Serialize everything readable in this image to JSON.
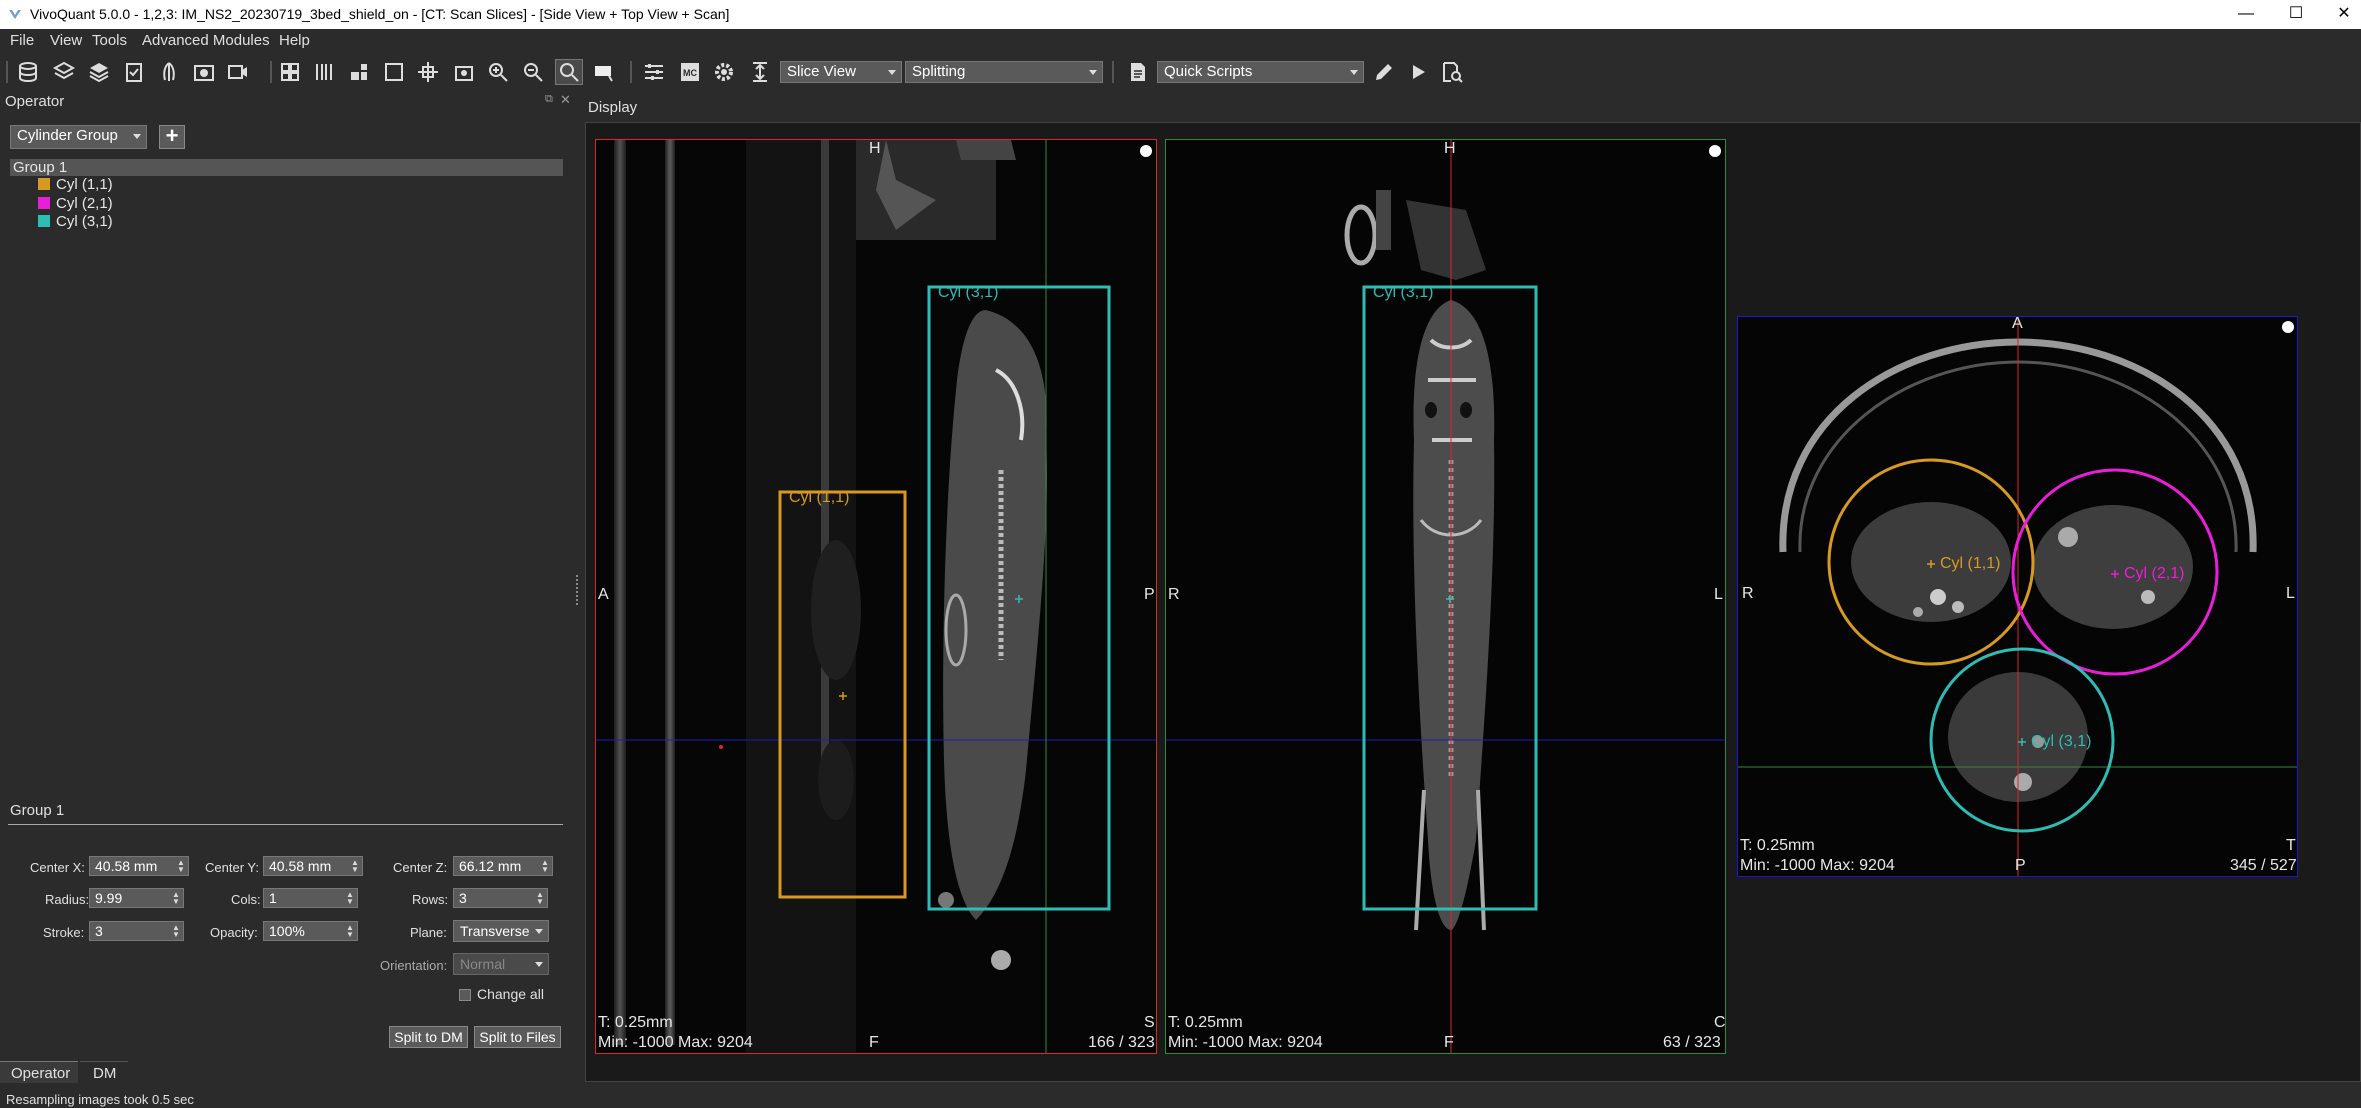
{
  "window": {
    "title": "VivoQuant 5.0.0 - 1,2,3: IM_NS2_20230719_3bed_shield_on - [CT: Scan Slices] - [Side View + Top View + Scan]",
    "minimize": "—",
    "maximize": "☐",
    "close": "✕"
  },
  "menu": {
    "file": "File",
    "view": "View",
    "tools": "Tools",
    "advanced": "Advanced Modules",
    "help": "Help"
  },
  "toolbar": {
    "view_mode": "Slice View",
    "split_mode": "Splitting",
    "quick_scripts": "Quick Scripts"
  },
  "operator": {
    "panel_title": "Operator",
    "group_type": "Cylinder Group",
    "add_label": "+",
    "tree": {
      "group": "Group 1",
      "items": [
        {
          "label": "Cyl (1,1)",
          "color": "#d69a23"
        },
        {
          "label": "Cyl (2,1)",
          "color": "#e81ed8"
        },
        {
          "label": "Cyl (3,1)",
          "color": "#2dbdb5"
        }
      ]
    },
    "properties_title": "Group 1",
    "center_x_label": "Center X:",
    "center_x": "40.58 mm",
    "center_y_label": "Center Y:",
    "center_y": "40.58 mm",
    "center_z_label": "Center Z:",
    "center_z": "66.12 mm",
    "radius_label": "Radius:",
    "radius": "9.99",
    "cols_label": "Cols:",
    "cols": "1",
    "rows_label": "Rows:",
    "rows": "3",
    "stroke_label": "Stroke:",
    "stroke": "3",
    "opacity_label": "Opacity:",
    "opacity": "100%",
    "plane_label": "Plane:",
    "plane": "Transverse",
    "orientation_label": "Orientation:",
    "orientation": "Normal",
    "change_all": "Change all",
    "split_dm": "Split to DM",
    "split_files": "Split to Files",
    "tab_operator": "Operator",
    "tab_dm": "DM"
  },
  "display": {
    "title": "Display",
    "view1": {
      "top": "H",
      "left": "A",
      "right": "P",
      "bottom": "F",
      "thickness": "T: 0.25mm",
      "minmax": "Min: -1000 Max: 9204",
      "corner": "S",
      "slice": "166 / 323",
      "roi1": "Cyl (3,1)",
      "roi2": "Cyl (1,1)"
    },
    "view2": {
      "top": "H",
      "left": "R",
      "right": "L",
      "bottom": "F",
      "thickness": "T: 0.25mm",
      "minmax": "Min: -1000 Max: 9204",
      "corner": "C",
      "slice": "63 / 323",
      "roi1": "Cyl (3,1)"
    },
    "view3": {
      "top": "A",
      "left": "R",
      "right": "L",
      "bottom": "P",
      "thickness": "T: 0.25mm",
      "minmax": "Min: -1000 Max: 9204",
      "corner": "T",
      "slice": "345 / 527",
      "c1": "Cyl (1,1)",
      "c2": "Cyl (2,1)",
      "c3": "Cyl (3,1)"
    }
  },
  "status": "Resampling images took 0.5 sec",
  "colors": {
    "orange": "#d69a23",
    "magenta": "#e81ed8",
    "teal": "#2dbdb5",
    "red": "#d42a2a",
    "green": "#2c8a3c",
    "blue": "#1a1ac8"
  }
}
